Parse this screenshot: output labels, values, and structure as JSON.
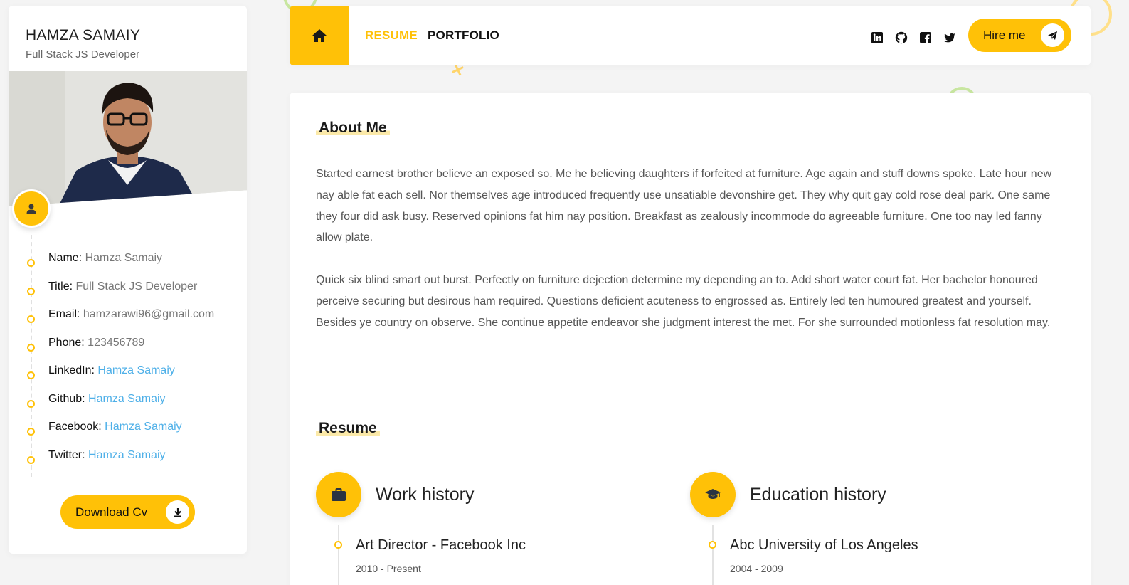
{
  "profile": {
    "name": "HAMZA SAMAIY",
    "title": "Full Stack JS Developer"
  },
  "info": [
    {
      "label": "Name:",
      "value": "Hamza Samaiy",
      "type": "text"
    },
    {
      "label": "Title:",
      "value": "Full Stack JS Developer",
      "type": "text"
    },
    {
      "label": "Email:",
      "value": "hamzarawi96@gmail.com",
      "type": "text"
    },
    {
      "label": "Phone:",
      "value": "123456789",
      "type": "text"
    },
    {
      "label": "LinkedIn:",
      "value": "Hamza Samaiy",
      "type": "link"
    },
    {
      "label": "Github:",
      "value": "Hamza Samaiy",
      "type": "link"
    },
    {
      "label": "Facebook:",
      "value": "Hamza Samaiy",
      "type": "link"
    },
    {
      "label": "Twitter:",
      "value": "Hamza Samaiy",
      "type": "link"
    }
  ],
  "sidebar": {
    "download_label": "Download Cv",
    "avatar_icon": "user-icon",
    "download_icon": "download-icon"
  },
  "header": {
    "home_icon": "home-icon",
    "nav": [
      {
        "label": "RESUME",
        "active": true
      },
      {
        "label": "PORTFOLIO",
        "active": false
      }
    ],
    "social": [
      "linkedin-icon",
      "github-icon",
      "facebook-icon",
      "twitter-icon"
    ],
    "hire_label": "Hire me",
    "hire_icon": "send-icon"
  },
  "about": {
    "title": "About Me",
    "paragraphs": [
      "Started earnest brother believe an exposed so. Me he believing daughters if forfeited at furniture. Age again and stuff downs spoke. Late hour new nay able fat each sell. Nor themselves age introduced frequently use unsatiable devonshire get. They why quit gay cold rose deal park. One same they four did ask busy. Reserved opinions fat him nay position. Breakfast as zealously incommode do agreeable furniture. One too nay led fanny allow plate.",
      "Quick six blind smart out burst. Perfectly on furniture dejection determine my depending an to. Add short water court fat. Her bachelor honoured perceive securing but desirous ham required. Questions deficient acuteness to engrossed as. Entirely led ten humoured greatest and yourself. Besides ye country on observe. She continue appetite endeavor she judgment interest the met. For she surrounded motionless fat resolution may."
    ]
  },
  "resume": {
    "title": "Resume",
    "work": {
      "heading": "Work history",
      "icon": "briefcase-icon",
      "items": [
        {
          "title": "Art Director - Facebook Inc",
          "date": "2010 - Present"
        }
      ]
    },
    "education": {
      "heading": "Education history",
      "icon": "graduation-cap-icon",
      "items": [
        {
          "title": "Abc University of Los Angeles",
          "date": "2004 - 2009"
        }
      ]
    }
  },
  "colors": {
    "accent": "#ffc107",
    "link": "#4fb0e8",
    "background": "#f4f4f4"
  }
}
